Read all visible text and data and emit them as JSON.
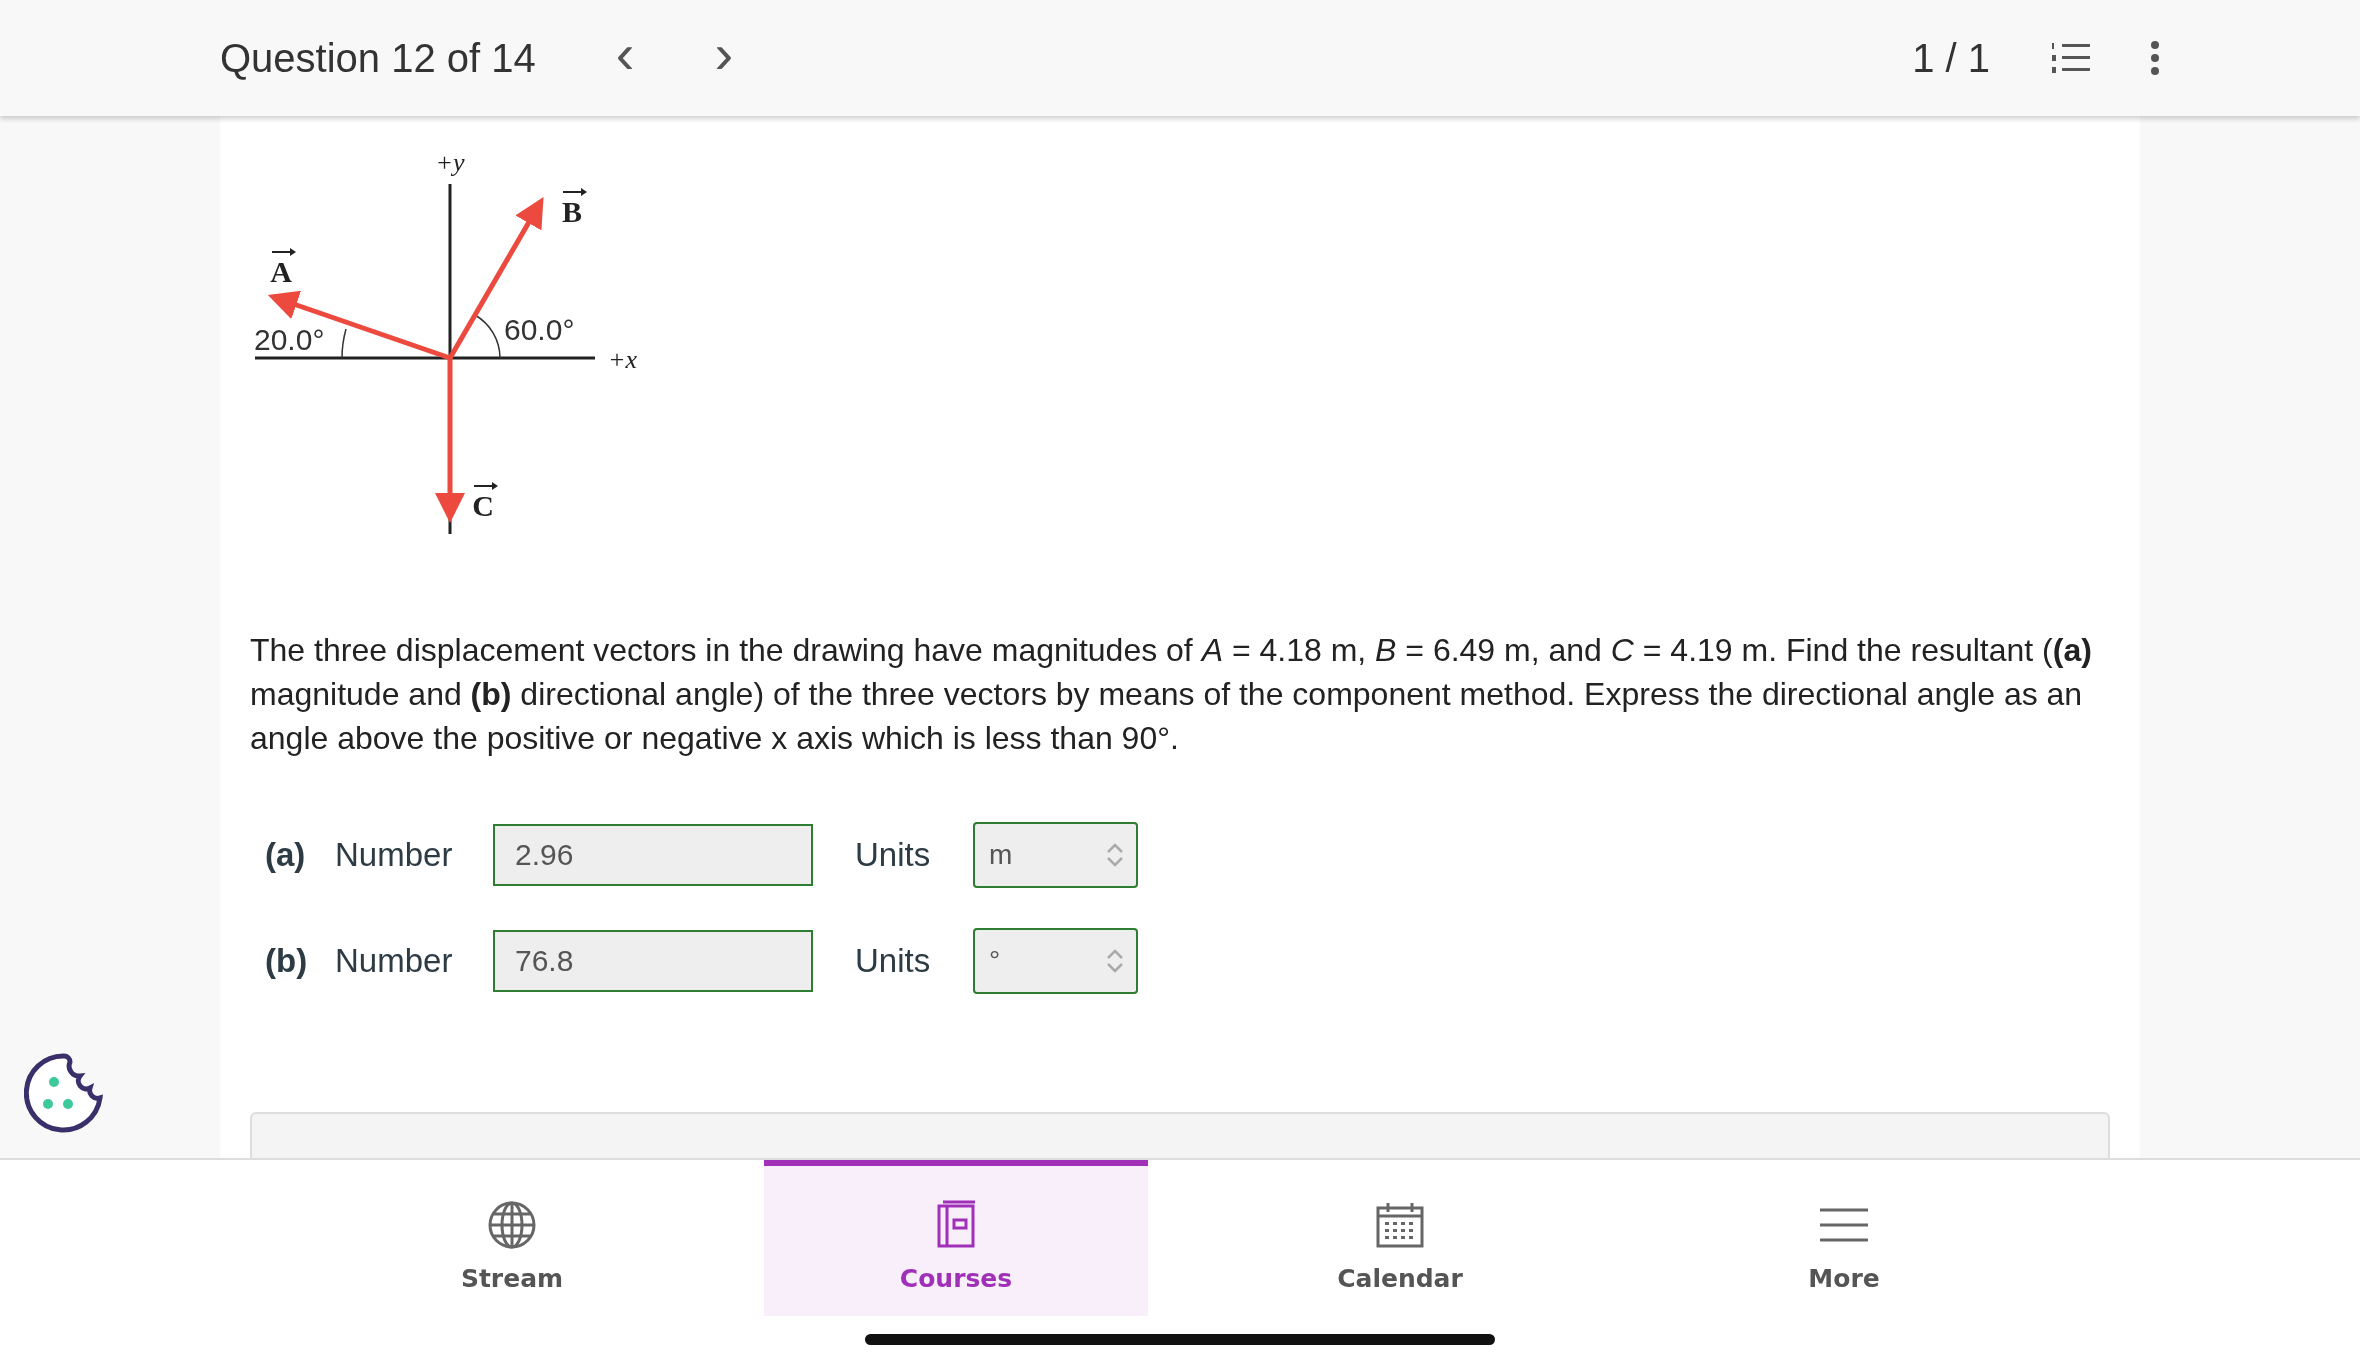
{
  "header": {
    "title": "Question 12 of 14",
    "prev": "‹",
    "next": "›",
    "page_count": "1 / 1"
  },
  "figure": {
    "y_axis": "+y",
    "x_axis": "+x",
    "vector_a": "A",
    "vector_b": "B",
    "vector_c": "C",
    "angle_a": "20.0°",
    "angle_b": "60.0°"
  },
  "question": "The three displacement vectors in the drawing have magnitudes of *A* = 4.18 m, *B* = 6.49 m, and *C* = 4.19 m. Find the resultant (**(a)** magnitude and **(b)** directional angle) of the three vectors by means of the component method. Express the directional angle as an angle above the positive or negative x axis which is less than 90°.",
  "answers": [
    {
      "part": "(a)",
      "label": "Number",
      "value": "2.96",
      "units_label": "Units",
      "unit": "m"
    },
    {
      "part": "(b)",
      "label": "Number",
      "value": "76.8",
      "units_label": "Units",
      "unit": "°"
    }
  ],
  "nav": [
    {
      "label": "Stream",
      "selected": false
    },
    {
      "label": "Courses",
      "selected": true
    },
    {
      "label": "Calendar",
      "selected": false
    },
    {
      "label": "More",
      "selected": false
    }
  ]
}
